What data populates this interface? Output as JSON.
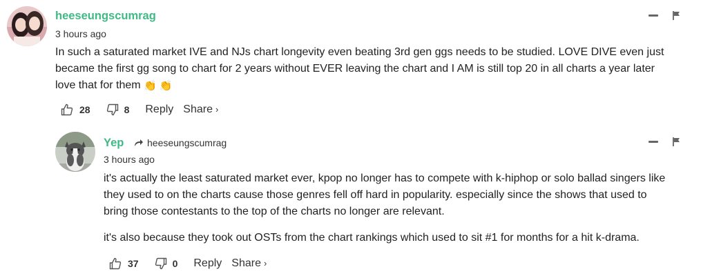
{
  "comments": [
    {
      "username": "heeseungscumrag",
      "avatar_icon": "user-avatar-photo",
      "time": "3 hours ago",
      "text_lines": [
        "In such a saturated market IVE and NJs chart longevity even beating 3rd gen ggs needs to be studied. LOVE DIVE even just",
        "became the first gg song to chart for 2 years without EVER leaving the chart and I AM is still top 20 in all charts a year later",
        "love that for them"
      ],
      "emojis": "👏 👏",
      "likes": "28",
      "dislikes": "8",
      "reply_label": "Reply",
      "share_label": "Share",
      "share_chevron": "›"
    },
    {
      "username": "Yep",
      "avatar_icon": "cat-avatar-photo",
      "reply_to": "heeseungscumrag",
      "time": "3 hours ago",
      "paragraph1_lines": [
        "it's actually the least saturated market ever, kpop no longer has to compete with k-hiphop or solo ballad singers like",
        "they used to on the charts cause those genres fell off hard in popularity. especially since the shows that used to",
        "bring those contestants to the top of the charts no longer are relevant."
      ],
      "paragraph2": "it's also because they took out OSTs from the chart rankings which used to sit #1 for months for a hit k-drama.",
      "likes": "37",
      "dislikes": "0",
      "reply_label": "Reply",
      "share_label": "Share",
      "share_chevron": "›"
    }
  ],
  "colors": {
    "username": "#3fba84",
    "text": "#222222",
    "icon": "#666666"
  }
}
